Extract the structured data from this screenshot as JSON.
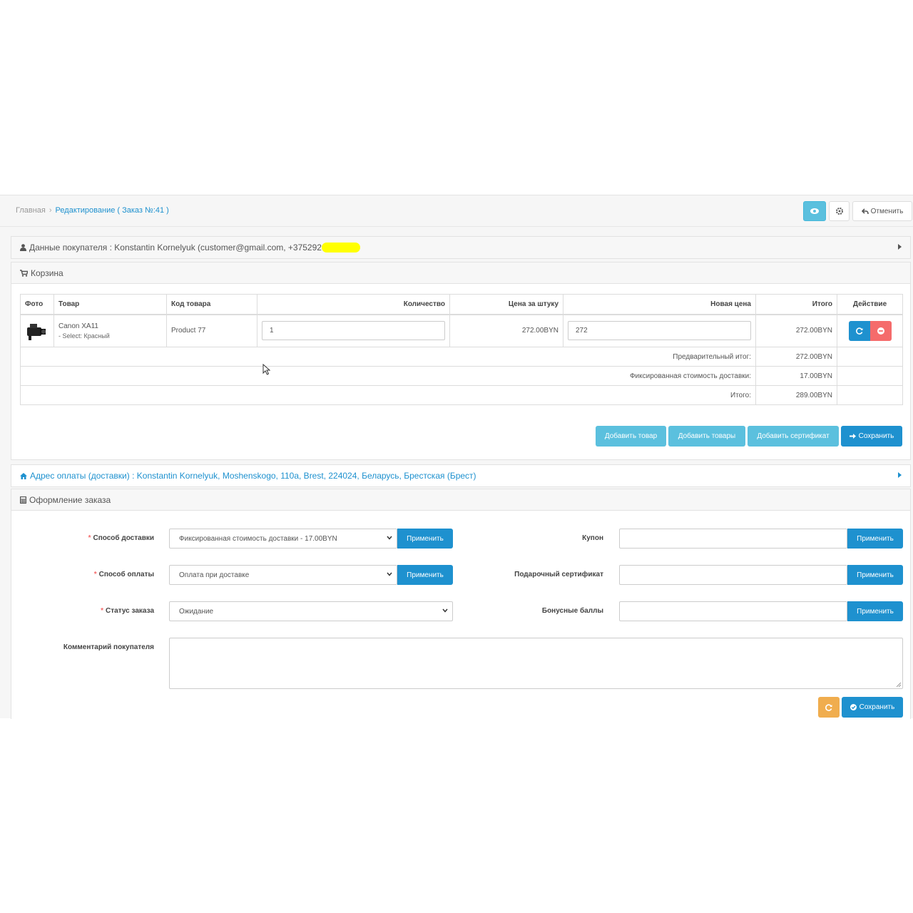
{
  "breadcrumb": {
    "home": "Главная",
    "separator": "›",
    "current": "Редактирование ( Заказ №:41 )"
  },
  "header_buttons": {
    "view_icon": "eye-icon",
    "settings_icon": "gear-icon",
    "cancel_label": "Отменить"
  },
  "customer_panel": {
    "title": "Данные покупателя : Konstantin Kornelyuk (customer@gmail.com, +375292",
    "icon": "user-icon"
  },
  "cart_panel": {
    "title": "Корзина",
    "icon": "cart-icon"
  },
  "cart_table": {
    "headers": {
      "photo": "Фото",
      "product": "Товар",
      "code": "Код товара",
      "qty": "Количество",
      "unit_price": "Цена за штуку",
      "new_price": "Новая цена",
      "total": "Итого",
      "action": "Действие"
    },
    "rows": [
      {
        "name": "Canon XA11",
        "option": "- Select: Красный",
        "code": "Product 77",
        "qty": "1",
        "unit_price": "272.00BYN",
        "new_price": "272",
        "total": "272.00BYN"
      }
    ],
    "totals": [
      {
        "label": "Предварительный итог:",
        "value": "272.00BYN"
      },
      {
        "label": "Фиксированная стоимость доставки:",
        "value": "17.00BYN"
      },
      {
        "label": "Итого:",
        "value": "289.00BYN"
      }
    ]
  },
  "cart_buttons": {
    "add_product": "Добавить товар",
    "add_products": "Добавить товары",
    "add_certificate": "Добавить сертификат",
    "save": "Сохранить"
  },
  "address_panel": {
    "title": "Адрес оплаты (доставки) : Konstantin Kornelyuk, Moshenskogo, 110a, Brest, 224024, Беларусь, Брестская (Брест)",
    "icon": "home-icon"
  },
  "order_panel": {
    "title": "Оформление заказа",
    "icon": "calculator-icon"
  },
  "order_form": {
    "shipping_label": "Способ доставки",
    "shipping_value": "Фиксированная стоимость доставки - 17.00BYN",
    "payment_label": "Способ оплаты",
    "payment_value": "Оплата при доставке",
    "status_label": "Статус заказа",
    "status_value": "Ожидание",
    "comment_label": "Комментарий покупателя",
    "coupon_label": "Купон",
    "gift_label": "Подарочный сертификат",
    "bonus_label": "Бонусные баллы",
    "apply_label": "Применить",
    "required_mark": "*",
    "save_label": "Сохранить"
  },
  "colors": {
    "primary": "#1e91cf",
    "info": "#5bc0de",
    "danger": "#f56b6b",
    "warning": "#f0ad4e",
    "highlight": "#ffff00"
  }
}
